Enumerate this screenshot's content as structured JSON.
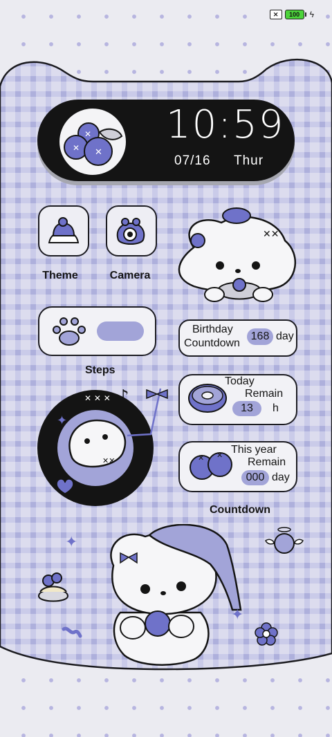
{
  "status_bar": {
    "battery": "100"
  },
  "clock": {
    "time": "10:59",
    "date": "07/16",
    "weekday": "Thur"
  },
  "apps": [
    {
      "label": "Theme",
      "icon": "theme-icon"
    },
    {
      "label": "Camera",
      "icon": "camera-icon"
    }
  ],
  "steps": {
    "label": "Steps"
  },
  "birthday": {
    "line1": "Birthday",
    "line2": "Countdown",
    "value": "168",
    "unit": "day"
  },
  "today": {
    "line1": "Today",
    "line2": "Remain",
    "value": "13",
    "unit": "h"
  },
  "year": {
    "line1": "This year",
    "line2": "Remain",
    "value": "000",
    "unit": "day"
  },
  "countdown": {
    "label": "Countdown"
  },
  "colors": {
    "accent": "#6f72c9",
    "chip": "#a2a4d8",
    "dark": "#141414",
    "plaid": "#c6c7e6"
  }
}
